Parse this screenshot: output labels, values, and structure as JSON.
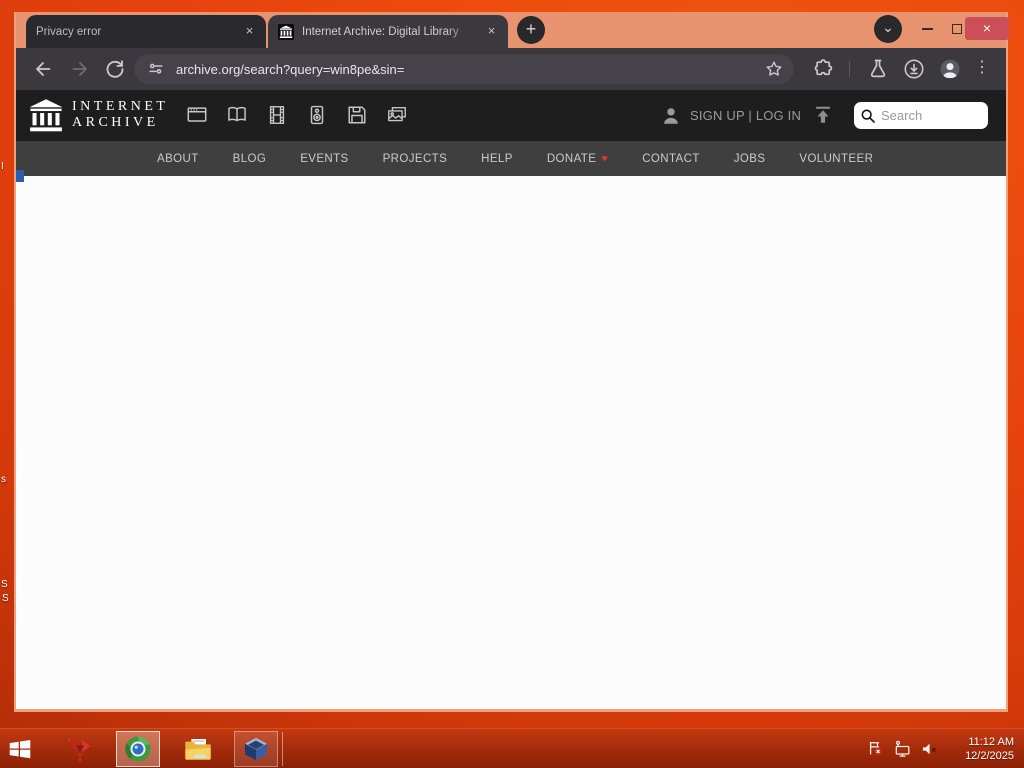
{
  "glyphs": {
    "close": "×",
    "plus": "+",
    "chevron_down": "⌄",
    "menu_dots": "⋮",
    "heart": "♥"
  },
  "browser": {
    "tabs": [
      {
        "title": "Privacy error"
      },
      {
        "title": "Internet Archive: Digital Library"
      }
    ],
    "url": "archive.org/search?query=win8pe&sin="
  },
  "ia": {
    "wordmark": [
      "INTERNET",
      "ARCHIVE"
    ],
    "auth": "SIGN UP | LOG IN",
    "search_placeholder": "Search",
    "nav": [
      "ABOUT",
      "BLOG",
      "EVENTS",
      "PROJECTS",
      "HELP",
      "DONATE",
      "CONTACT",
      "JOBS",
      "VOLUNTEER"
    ]
  },
  "taskbar": {
    "time": "11:12 AM",
    "date": "12/2/2025"
  },
  "desktop": {
    "stray_labels": [
      "I",
      "s",
      "S",
      "S"
    ]
  },
  "colors": {
    "desktop_orange": "#e8430e",
    "frame_salmon": "#e99470",
    "toolbar_dark": "#3b393e",
    "tab_inactive": "#2a292d",
    "ia_header_black": "#1e1e1e",
    "ia_nav_gray": "#3f3f3f",
    "taskbar_red": "#a72d0c",
    "close_button_red": "#cb4f58",
    "heart_red": "#e03131"
  }
}
